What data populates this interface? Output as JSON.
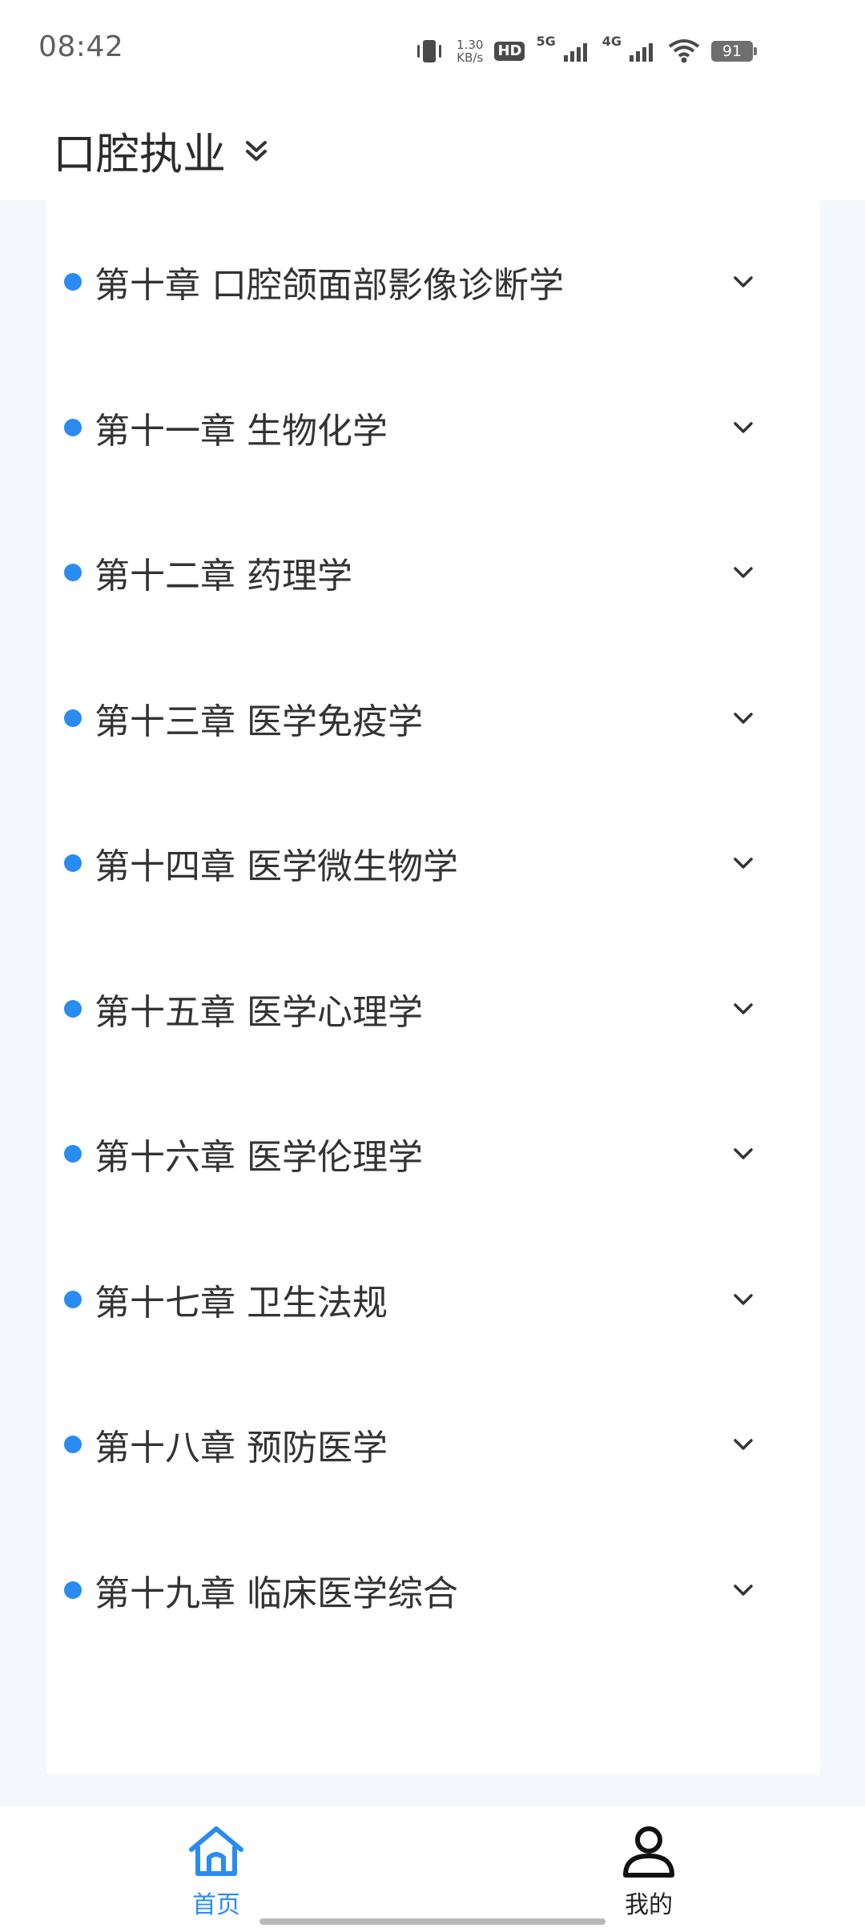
{
  "status_bar": {
    "time": "08:42",
    "net_speed_value": "1.30",
    "net_speed_unit": "KB/s",
    "hd_label": "HD",
    "net_5g": "5G",
    "net_4g": "4G",
    "battery": "91"
  },
  "header": {
    "title": "口腔执业"
  },
  "chapters": [
    {
      "label": "第十章 口腔颌面部影像诊断学"
    },
    {
      "label": "第十一章 生物化学"
    },
    {
      "label": "第十二章 药理学"
    },
    {
      "label": "第十三章 医学免疫学"
    },
    {
      "label": "第十四章 医学微生物学"
    },
    {
      "label": "第十五章 医学心理学"
    },
    {
      "label": "第十六章 医学伦理学"
    },
    {
      "label": "第十七章 卫生法规"
    },
    {
      "label": "第十八章 预防医学"
    },
    {
      "label": "第十九章 临床医学综合"
    }
  ],
  "bottom_nav": {
    "home_label": "首页",
    "mine_label": "我的"
  },
  "colors": {
    "accent": "#2a8bf2",
    "page_background": "#f4f7fc"
  },
  "icons": {
    "header": "double-chevron-down-icon",
    "chapter_toggle": "chevron-down-icon",
    "home": "home-icon",
    "mine": "person-icon"
  }
}
